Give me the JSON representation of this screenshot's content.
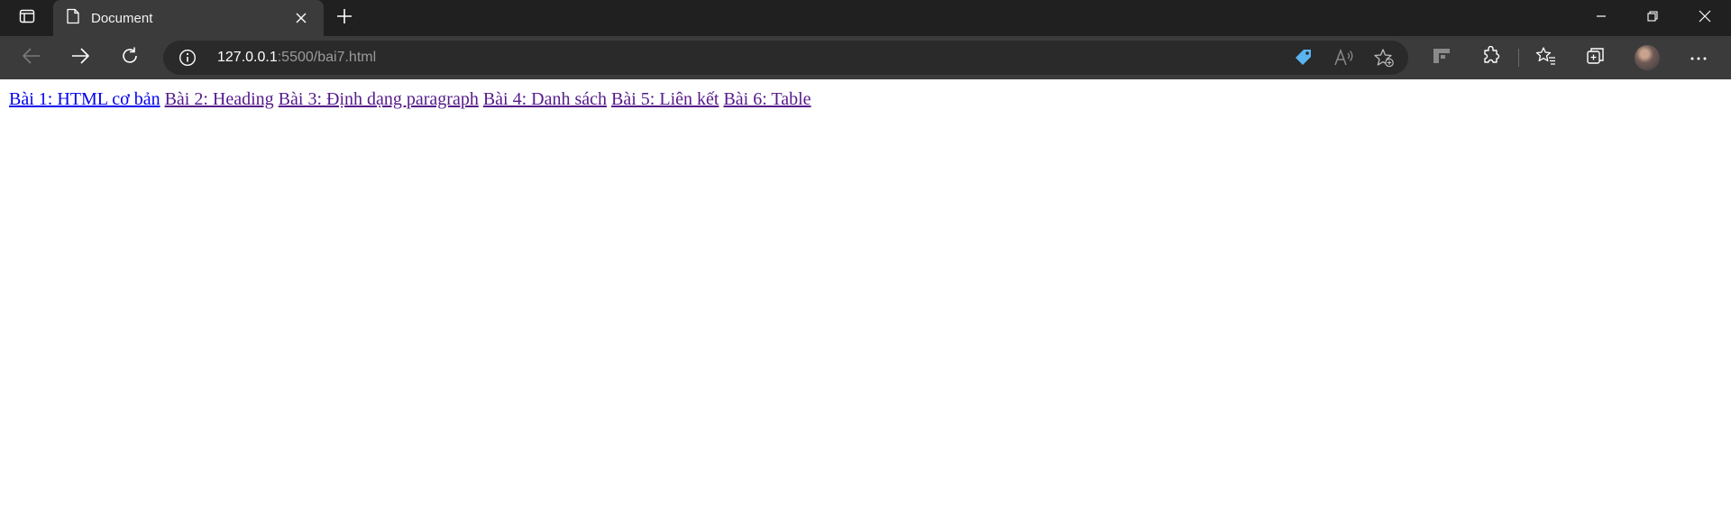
{
  "tab": {
    "title": "Document"
  },
  "address_bar": {
    "host": "127.0.0.1",
    "rest": ":5500/bai7.html"
  },
  "links": [
    {
      "label": "Bài 1: HTML cơ bản",
      "state": "unvisited"
    },
    {
      "label": "Bài 2: Heading",
      "state": "visited"
    },
    {
      "label": "Bài 3: Định dạng paragraph",
      "state": "visited"
    },
    {
      "label": "Bài 4: Danh sách",
      "state": "visited"
    },
    {
      "label": "Bài 5: Liên kết",
      "state": "visited"
    },
    {
      "label": "Bài 6: Table",
      "state": "visited"
    }
  ],
  "colors": {
    "link_unvisited": "#0000ee",
    "link_visited": "#551a8b",
    "tabstrip_bg": "#202020",
    "toolbar_bg": "#3b3b3b",
    "coupon_icon": "#5ab4f0"
  },
  "icons": [
    "tab-actions-icon",
    "page-icon",
    "close-icon",
    "plus-icon",
    "minimize-icon",
    "restore-icon",
    "window-close-icon",
    "back-arrow-icon",
    "forward-arrow-icon",
    "refresh-icon",
    "info-icon",
    "coupon-tag-icon",
    "read-aloud-icon",
    "add-favorite-icon",
    "sidebar-app-icon",
    "extensions-icon",
    "favorites-icon",
    "collections-icon",
    "avatar",
    "more-icon"
  ]
}
